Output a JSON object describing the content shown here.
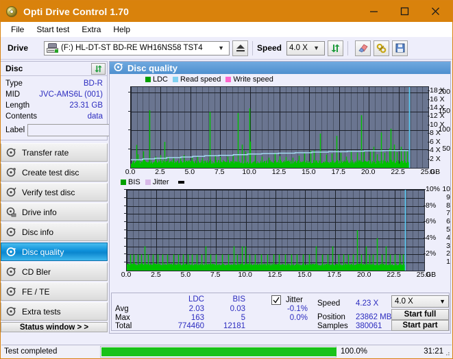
{
  "window": {
    "title": "Opti Drive Control 1.70",
    "icon": "disc-icon",
    "minimize": "minimize-icon",
    "maximize": "maximize-icon",
    "close": "close-icon",
    "accent_color": "#d9820c"
  },
  "menu": {
    "items": [
      "File",
      "Start test",
      "Extra",
      "Help"
    ]
  },
  "drivebar": {
    "label": "Drive",
    "drive_value": "(F:)  HL-DT-ST BD-RE  WH16NS58 TST4",
    "eject_icon": "eject-icon",
    "speed_label": "Speed",
    "speed_value": "4.0 X",
    "refresh_icon": "refresh-icon",
    "erase_icon": "eraser-icon",
    "tools_icon": "tools-icon",
    "save_icon": "save-icon"
  },
  "disc_panel": {
    "title": "Disc",
    "refresh_icon": "refresh-icon",
    "rows": [
      {
        "key": "Type",
        "value": "BD-R"
      },
      {
        "key": "MID",
        "value": "JVC-AMS6L (001)"
      },
      {
        "key": "Length",
        "value": "23.31 GB"
      },
      {
        "key": "Contents",
        "value": "data"
      }
    ],
    "label_key": "Label",
    "label_value": "",
    "label_placeholder": "",
    "disc_button_icon": "cd-icon"
  },
  "nav": {
    "items": [
      {
        "label": "Transfer rate",
        "icon": "disc-speed-icon",
        "selected": false
      },
      {
        "label": "Create test disc",
        "icon": "disc-write-icon",
        "selected": false
      },
      {
        "label": "Verify test disc",
        "icon": "disc-verify-icon",
        "selected": false
      },
      {
        "label": "Drive info",
        "icon": "drive-info-icon",
        "selected": false
      },
      {
        "label": "Disc info",
        "icon": "disc-info-icon",
        "selected": false
      },
      {
        "label": "Disc quality",
        "icon": "disc-quality-icon",
        "selected": true
      },
      {
        "label": "CD Bler",
        "icon": "cd-bler-icon",
        "selected": false
      },
      {
        "label": "FE / TE",
        "icon": "fe-te-icon",
        "selected": false
      },
      {
        "label": "Extra tests",
        "icon": "extra-tests-icon",
        "selected": false
      }
    ],
    "status_window": "Status window > >"
  },
  "content": {
    "header": "Disc quality",
    "header_icon": "disc-quality-icon"
  },
  "chart_data": [
    {
      "type": "line",
      "name": "ldc-chart",
      "title": "",
      "legend": [
        {
          "label": "LDC",
          "color": "#00a000"
        },
        {
          "label": "Read speed",
          "color": "#80d0f0"
        },
        {
          "label": "Write speed",
          "color": "#ff66cc"
        }
      ],
      "legend_position": "top",
      "grid": true,
      "xlabel": "GB",
      "xlim": [
        0,
        25
      ],
      "xticks": [
        0.0,
        2.5,
        5.0,
        7.5,
        10.0,
        12.5,
        15.0,
        17.5,
        20.0,
        22.5,
        25.0
      ],
      "xticklabels": [
        "0.0",
        "2.5",
        "5.0",
        "7.5",
        "10.0",
        "12.5",
        "15.0",
        "17.5",
        "20.0",
        "22.5",
        "25.0"
      ],
      "ylabel": "",
      "ylim": [
        0,
        215
      ],
      "yticks": [
        50,
        100,
        150,
        200
      ],
      "yticklabels": [
        "50",
        "100",
        "150",
        "200"
      ],
      "y2label": "",
      "y2lim": [
        0,
        19
      ],
      "y2ticks": [
        2,
        4,
        6,
        8,
        10,
        12,
        14,
        16,
        18
      ],
      "y2ticklabels": [
        "2 X",
        "4 X",
        "6 X",
        "8 X",
        "10 X",
        "12 X",
        "14 X",
        "16 X",
        "18 X"
      ],
      "data_end_gb": 23.4,
      "series": [
        {
          "name": "LDC",
          "color": "#00c000",
          "kind": "impulse",
          "baseline": 14,
          "noise_amplitude": 10,
          "spikes": [
            {
              "x": 0.45,
              "y": 61
            },
            {
              "x": 0.55,
              "y": 36
            },
            {
              "x": 1.05,
              "y": 44
            },
            {
              "x": 1.55,
              "y": 153
            },
            {
              "x": 2.05,
              "y": 30
            },
            {
              "x": 2.45,
              "y": 34
            },
            {
              "x": 2.8,
              "y": 69
            },
            {
              "x": 3.1,
              "y": 30
            },
            {
              "x": 3.55,
              "y": 26
            },
            {
              "x": 4.15,
              "y": 30
            },
            {
              "x": 4.45,
              "y": 34
            },
            {
              "x": 5.1,
              "y": 27
            },
            {
              "x": 5.6,
              "y": 30
            },
            {
              "x": 6.0,
              "y": 26
            },
            {
              "x": 6.6,
              "y": 149
            },
            {
              "x": 7.1,
              "y": 33
            },
            {
              "x": 7.5,
              "y": 29
            },
            {
              "x": 8.1,
              "y": 30
            },
            {
              "x": 8.6,
              "y": 34
            },
            {
              "x": 9.0,
              "y": 146
            },
            {
              "x": 9.35,
              "y": 62
            },
            {
              "x": 9.6,
              "y": 44
            },
            {
              "x": 9.95,
              "y": 158
            },
            {
              "x": 10.05,
              "y": 70
            },
            {
              "x": 10.4,
              "y": 33
            },
            {
              "x": 11.0,
              "y": 30
            },
            {
              "x": 11.6,
              "y": 27
            },
            {
              "x": 12.1,
              "y": 40
            },
            {
              "x": 12.5,
              "y": 31
            },
            {
              "x": 13.0,
              "y": 29
            },
            {
              "x": 13.6,
              "y": 27
            },
            {
              "x": 14.1,
              "y": 32
            },
            {
              "x": 14.6,
              "y": 38
            },
            {
              "x": 15.1,
              "y": 45
            },
            {
              "x": 15.4,
              "y": 47
            },
            {
              "x": 15.9,
              "y": 91
            },
            {
              "x": 16.4,
              "y": 35
            },
            {
              "x": 16.9,
              "y": 38
            },
            {
              "x": 17.3,
              "y": 85
            },
            {
              "x": 17.6,
              "y": 40
            },
            {
              "x": 18.1,
              "y": 30
            },
            {
              "x": 18.5,
              "y": 46
            },
            {
              "x": 19.0,
              "y": 40
            },
            {
              "x": 19.35,
              "y": 140
            },
            {
              "x": 19.6,
              "y": 44
            },
            {
              "x": 20.1,
              "y": 43
            },
            {
              "x": 20.4,
              "y": 56
            },
            {
              "x": 20.7,
              "y": 36
            },
            {
              "x": 21.0,
              "y": 94
            },
            {
              "x": 21.3,
              "y": 40
            },
            {
              "x": 21.7,
              "y": 52
            },
            {
              "x": 21.85,
              "y": 104
            },
            {
              "x": 22.1,
              "y": 62
            },
            {
              "x": 22.35,
              "y": 42
            },
            {
              "x": 22.7,
              "y": 56
            },
            {
              "x": 23.0,
              "y": 48
            },
            {
              "x": 23.2,
              "y": 44
            }
          ]
        },
        {
          "name": "Read speed",
          "color": "#a8e0f8",
          "kind": "step-line",
          "points": [
            {
              "x": 0.0,
              "y": 1.9
            },
            {
              "x": 1.0,
              "y": 2.1
            },
            {
              "x": 2.0,
              "y": 2.25
            },
            {
              "x": 3.0,
              "y": 2.4
            },
            {
              "x": 4.2,
              "y": 2.55
            },
            {
              "x": 5.2,
              "y": 2.7
            },
            {
              "x": 6.2,
              "y": 2.85
            },
            {
              "x": 7.4,
              "y": 2.95
            },
            {
              "x": 8.6,
              "y": 3.1
            },
            {
              "x": 9.8,
              "y": 3.25
            },
            {
              "x": 11.0,
              "y": 3.35
            },
            {
              "x": 12.4,
              "y": 3.45
            },
            {
              "x": 13.8,
              "y": 3.55
            },
            {
              "x": 15.2,
              "y": 3.7
            },
            {
              "x": 16.6,
              "y": 3.8
            },
            {
              "x": 18.2,
              "y": 3.9
            },
            {
              "x": 19.6,
              "y": 4.0
            },
            {
              "x": 21.2,
              "y": 4.05
            },
            {
              "x": 23.3,
              "y": 4.1
            }
          ]
        },
        {
          "name": "Write speed",
          "color": "#ff66cc",
          "kind": "none",
          "points": []
        }
      ],
      "end_marker": {
        "x": 23.4,
        "color": "#56c8f0"
      }
    },
    {
      "type": "line",
      "name": "bis-chart",
      "title": "",
      "legend": [
        {
          "label": "BIS",
          "color": "#00a000"
        },
        {
          "label": "Jitter",
          "color": "#d8b8e8"
        }
      ],
      "legend_position": "top",
      "grid": true,
      "xlabel": "GB",
      "xlim": [
        0,
        25
      ],
      "xticks": [
        0.0,
        2.5,
        5.0,
        7.5,
        10.0,
        12.5,
        15.0,
        17.5,
        20.0,
        22.5,
        25.0
      ],
      "xticklabels": [
        "0.0",
        "2.5",
        "5.0",
        "7.5",
        "10.0",
        "12.5",
        "15.0",
        "17.5",
        "20.0",
        "22.5",
        "25.0"
      ],
      "ylim": [
        0,
        10
      ],
      "yticks": [
        1,
        2,
        3,
        4,
        5,
        6,
        7,
        8,
        9,
        10
      ],
      "yticklabels": [
        "1",
        "2",
        "3",
        "4",
        "5",
        "6",
        "7",
        "8",
        "9",
        "10"
      ],
      "y2lim": [
        0,
        10
      ],
      "y2ticks": [
        2,
        4,
        6,
        8,
        10
      ],
      "y2ticklabels": [
        "2%",
        "4%",
        "6%",
        "8%",
        "10%"
      ],
      "data_end_gb": 23.4,
      "series": [
        {
          "name": "BIS",
          "color": "#00c000",
          "kind": "impulse",
          "baseline": 1.0,
          "noise_amplitude": 0.25,
          "spikes": [
            {
              "x": 0.3,
              "y": 2
            },
            {
              "x": 0.6,
              "y": 2
            },
            {
              "x": 0.9,
              "y": 2
            },
            {
              "x": 1.2,
              "y": 2
            },
            {
              "x": 1.5,
              "y": 3
            },
            {
              "x": 1.8,
              "y": 2
            },
            {
              "x": 2.2,
              "y": 2
            },
            {
              "x": 2.6,
              "y": 2
            },
            {
              "x": 3.0,
              "y": 2
            },
            {
              "x": 3.4,
              "y": 2
            },
            {
              "x": 3.9,
              "y": 2
            },
            {
              "x": 4.3,
              "y": 2
            },
            {
              "x": 4.7,
              "y": 2
            },
            {
              "x": 5.1,
              "y": 2
            },
            {
              "x": 5.5,
              "y": 2
            },
            {
              "x": 5.9,
              "y": 2
            },
            {
              "x": 6.3,
              "y": 2
            },
            {
              "x": 6.6,
              "y": 3
            },
            {
              "x": 7.0,
              "y": 2
            },
            {
              "x": 7.5,
              "y": 2
            },
            {
              "x": 8.0,
              "y": 2
            },
            {
              "x": 8.5,
              "y": 2
            },
            {
              "x": 9.0,
              "y": 3
            },
            {
              "x": 9.3,
              "y": 2
            },
            {
              "x": 9.7,
              "y": 3
            },
            {
              "x": 9.95,
              "y": 3
            },
            {
              "x": 10.3,
              "y": 2
            },
            {
              "x": 10.8,
              "y": 2
            },
            {
              "x": 11.3,
              "y": 2
            },
            {
              "x": 11.8,
              "y": 2
            },
            {
              "x": 12.3,
              "y": 2
            },
            {
              "x": 12.8,
              "y": 2
            },
            {
              "x": 13.3,
              "y": 2
            },
            {
              "x": 13.8,
              "y": 2
            },
            {
              "x": 14.3,
              "y": 2
            },
            {
              "x": 14.8,
              "y": 2
            },
            {
              "x": 15.3,
              "y": 2
            },
            {
              "x": 15.9,
              "y": 3
            },
            {
              "x": 16.4,
              "y": 2
            },
            {
              "x": 16.9,
              "y": 2
            },
            {
              "x": 17.3,
              "y": 3
            },
            {
              "x": 17.8,
              "y": 2
            },
            {
              "x": 18.2,
              "y": 2
            },
            {
              "x": 18.6,
              "y": 2
            },
            {
              "x": 19.0,
              "y": 2
            },
            {
              "x": 19.35,
              "y": 5
            },
            {
              "x": 19.7,
              "y": 2
            },
            {
              "x": 20.1,
              "y": 3
            },
            {
              "x": 20.4,
              "y": 2
            },
            {
              "x": 20.7,
              "y": 2
            },
            {
              "x": 21.0,
              "y": 4
            },
            {
              "x": 21.4,
              "y": 2
            },
            {
              "x": 21.8,
              "y": 3
            },
            {
              "x": 22.1,
              "y": 2
            },
            {
              "x": 22.5,
              "y": 2
            },
            {
              "x": 22.9,
              "y": 2
            },
            {
              "x": 23.2,
              "y": 2
            }
          ]
        },
        {
          "name": "Jitter",
          "color": "#d8b8e8",
          "kind": "none",
          "points": []
        }
      ],
      "end_marker": {
        "x": 23.4,
        "color": "#56c8f0"
      }
    }
  ],
  "stats": {
    "col_headers": [
      "LDC",
      "BIS"
    ],
    "jitter_label": "Jitter",
    "jitter_checked": true,
    "rows": [
      {
        "label": "Avg",
        "ldc": "2.03",
        "bis": "0.03",
        "jitter": "-0.1%"
      },
      {
        "label": "Max",
        "ldc": "163",
        "bis": "5",
        "jitter": "0.0%"
      },
      {
        "label": "Total",
        "ldc": "774460",
        "bis": "12181",
        "jitter": ""
      }
    ],
    "speed_label": "Speed",
    "speed_value": "4.23 X",
    "position_label": "Position",
    "position_value": "23862 MB",
    "samples_label": "Samples",
    "samples_value": "380061",
    "speed_select": "4.0 X",
    "start_full": "Start full",
    "start_part": "Start part"
  },
  "statusbar": {
    "message": "Test completed",
    "progress_pct": 100,
    "progress_text": "100.0%",
    "elapsed": "31:21",
    "progress_color": "#19c219"
  }
}
